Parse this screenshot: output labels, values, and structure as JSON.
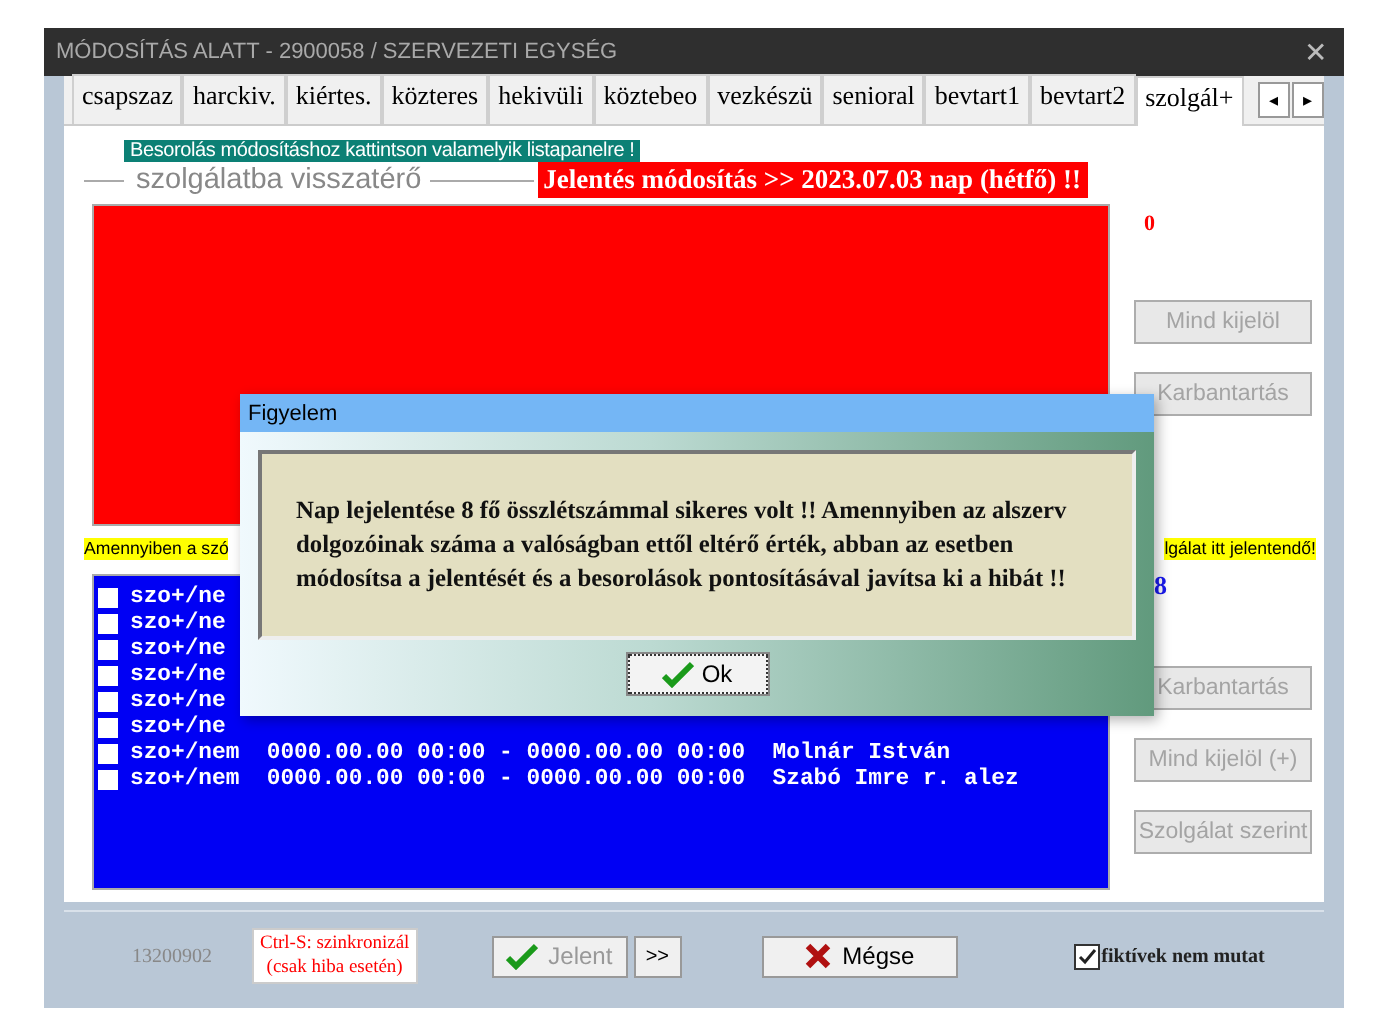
{
  "window": {
    "title": "MÓDOSÍTÁS ALATT - 2900058 / SZERVEZETI EGYSÉG",
    "close": "✕"
  },
  "tabs": [
    {
      "label": "csapszaz",
      "selected": false
    },
    {
      "label": "harckiv.",
      "selected": false
    },
    {
      "label": "kiértes.",
      "selected": false
    },
    {
      "label": "közteres",
      "selected": false
    },
    {
      "label": "hekivüli",
      "selected": false
    },
    {
      "label": "köztebeo",
      "selected": false
    },
    {
      "label": "vezkészü",
      "selected": false
    },
    {
      "label": "senioral",
      "selected": false
    },
    {
      "label": "bevtart1",
      "selected": false
    },
    {
      "label": "bevtart2",
      "selected": false
    },
    {
      "label": "szolgál+",
      "selected": true
    }
  ],
  "tab_scroll": [
    "◂",
    "▸"
  ],
  "hint": "Besorolás módosításhoz kattintson valamelyik listapanelre !",
  "section_title": "szolgálatba visszatérő",
  "alert_banner": "Jelentés módosítás >> 2023.07.03 nap (hétfő) !!",
  "top_count": "0",
  "top_buttons": [
    {
      "label": "Mind kijelöl",
      "disabled": true
    },
    {
      "label": "Karbantartás",
      "disabled": true
    }
  ],
  "warning_left": "Amennyiben a szó",
  "warning_right": "lgálat itt jelentendő!",
  "bottom_count": "8",
  "rows": [
    {
      "text": "szo+/ne",
      "checked": false
    },
    {
      "text": "szo+/ne",
      "checked": false
    },
    {
      "text": "szo+/ne",
      "checked": false
    },
    {
      "text": "szo+/ne",
      "checked": false
    },
    {
      "text": "szo+/ne",
      "checked": false
    },
    {
      "text": "szo+/ne",
      "checked": false
    },
    {
      "text": "szo+/nem  0000.00.00 00:00 - 0000.00.00 00:00  Molnár István",
      "checked": false
    },
    {
      "text": "szo+/nem  0000.00.00 00:00 - 0000.00.00 00:00  Szabó Imre r. alez",
      "checked": false
    }
  ],
  "bottom_buttons": [
    {
      "label": "Karbantartás",
      "disabled": true
    },
    {
      "label": "Mind kijelöl (+)",
      "disabled": true
    },
    {
      "label": "Szolgálat szerint",
      "disabled": true
    }
  ],
  "footer": {
    "code": "13200902",
    "sync_note": [
      "Ctrl-S: szinkronizál",
      "(csak hiba esetén)"
    ],
    "report_button": {
      "label": "Jelent",
      "disabled": true
    },
    "next_button": ">>",
    "cancel_button": "Mégse",
    "hide_fictive": {
      "label": "fiktívek nem mutat",
      "checked": true
    }
  },
  "dialog": {
    "title": "Figyelem",
    "message": "Nap lejelentése 8 fő összlétszámmal sikeres volt !! Amennyiben az alszerv dolgozóinak száma a valóságban ettől eltérő érték, abban az esetben módosítsa a jelentését és a besorolások pontosításával javítsa ki a hibát !!",
    "ok": "Ok"
  }
}
